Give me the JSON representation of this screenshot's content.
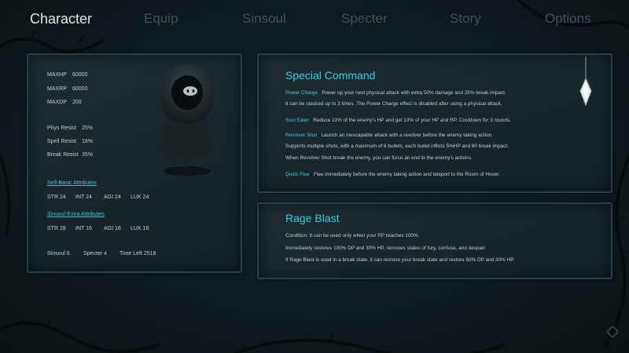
{
  "tabs": [
    "Character",
    "Equip",
    "Sinsoul",
    "Specter",
    "Story",
    "Options"
  ],
  "stats": {
    "maxhp_label": "MAXHP",
    "maxhp": "60000",
    "maxrp_label": "MAXRP",
    "maxrp": "60000",
    "maxdp_label": "MAXDP",
    "maxdp": "200"
  },
  "resist": {
    "phys_label": "Phys Resist",
    "phys": "25%",
    "spell_label": "Spell Resist",
    "spell": "18%",
    "break_label": "Break Resist",
    "break": "35%"
  },
  "self_basic": {
    "title": "Self-Basic Attributes",
    "str": "STR  24",
    "int": "INT  24",
    "agi": "AGI  24",
    "luk": "LUK  24"
  },
  "sinsoul_extra": {
    "title": "Sinsoul-Extra Attributes",
    "str": "STR  28",
    "int": "INT  16",
    "agi": "AGI  16",
    "luk": "LUK  16"
  },
  "footer": {
    "sinsoul": "Sinsoul  6",
    "specter": "Specter  4",
    "time_left": "Time Left  2518"
  },
  "special_command": {
    "title": "Special Command",
    "power_charge_name": "Power Charge",
    "power_charge_desc1": "Power up your next physical attack with extra 50% damage and 25% break impact.",
    "power_charge_desc2": "It can be stacked up to 3 times .The Power Charge effect is disabled after using a physical attack.",
    "soul_eater_name": "Soul Eater",
    "soul_eater_desc": "Reduce 10% of the enemy's HP and get 10% of your HP and RP. Cooldown for 3 rounds.",
    "revolver_shot_name": "Revolver Shot",
    "revolver_shot_desc1": "Launch an inescapable attack with a revolver before the enemy taking action.",
    "revolver_shot_desc2": "Supports multiple shots, with a maximum of 6 bullets, each bullet inflicts 5%HP and 80 break impact.",
    "revolver_shot_desc3": "When Revolver Shot break the enemy, you can force an end to the enemy's actions.",
    "quick_flee_name": "Quick Flee",
    "quick_flee_desc": "Flee immediately before the enemy taking action and teleport to the Room of Hover."
  },
  "rage_blast": {
    "title": "Rage Blast",
    "line1": "Condition:  It can be used only when your RP reaches 100%.",
    "line2": "Immediately restores 100% DP and 30% HP, removes states of fury, confuse, and despair.",
    "line3": "If Rage Blast is used in a break state, it can remove your break state and restore 50% DP and 30% HP."
  },
  "colors": {
    "accent": "#3fcbe0",
    "active_tab": "#dfe6e8",
    "inactive_tab": "#3f5258"
  }
}
